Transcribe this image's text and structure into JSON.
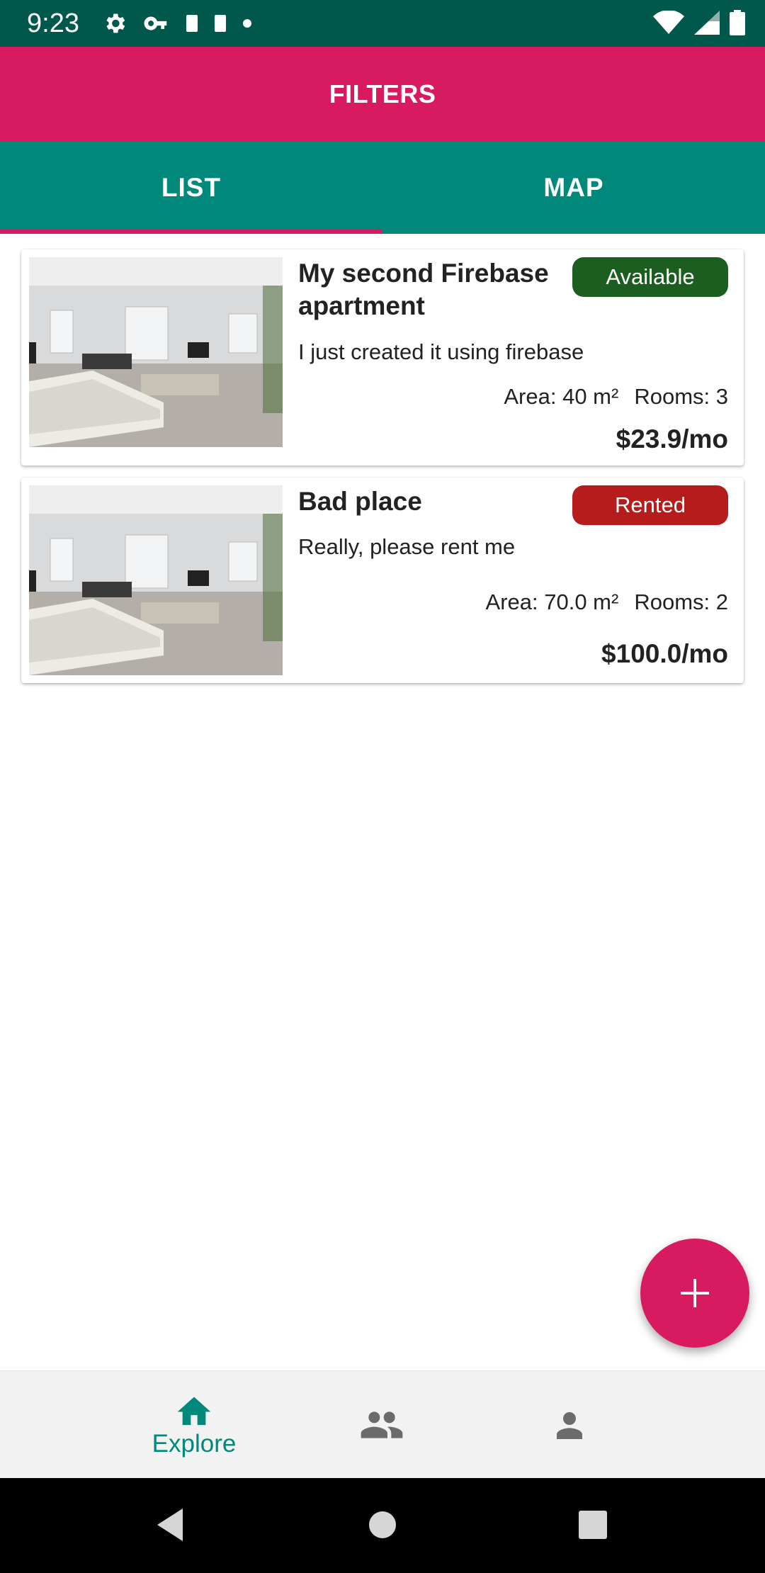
{
  "status_bar": {
    "time": "9:23",
    "left_icons": [
      "gear-icon",
      "key-icon",
      "sim-icon",
      "sim-icon",
      "dot-icon"
    ],
    "right_icons": [
      "wifi-icon",
      "signal-icon",
      "battery-icon"
    ]
  },
  "filters": {
    "label": "FILTERS"
  },
  "tabs": [
    {
      "label": "LIST",
      "selected": true
    },
    {
      "label": "MAP",
      "selected": false
    }
  ],
  "listings": [
    {
      "title": "My second Firebase apartment",
      "description": "I just created it using firebase",
      "status": "Available",
      "status_color": "#1b5e20",
      "area": "Area: 40 m²",
      "rooms": "Rooms: 3",
      "price": "$23.9/mo"
    },
    {
      "title": "Bad place",
      "description": "Really, please rent me",
      "status": "Rented",
      "status_color": "#b71c1c",
      "area": "Area: 70.0 m²",
      "rooms": "Rooms: 2",
      "price": "$100.0/mo"
    }
  ],
  "fab": {
    "icon": "plus-icon"
  },
  "bottom_nav": {
    "items": [
      {
        "label": "Explore",
        "icon": "home-icon",
        "selected": true
      },
      {
        "label": "",
        "icon": "people-icon",
        "selected": false
      },
      {
        "label": "",
        "icon": "person-icon",
        "selected": false
      }
    ]
  },
  "system_nav": [
    "back-icon",
    "home-circle-icon",
    "recents-icon"
  ],
  "colors": {
    "primary": "#00897b",
    "primary_dark": "#00574b",
    "accent": "#d81b60"
  }
}
